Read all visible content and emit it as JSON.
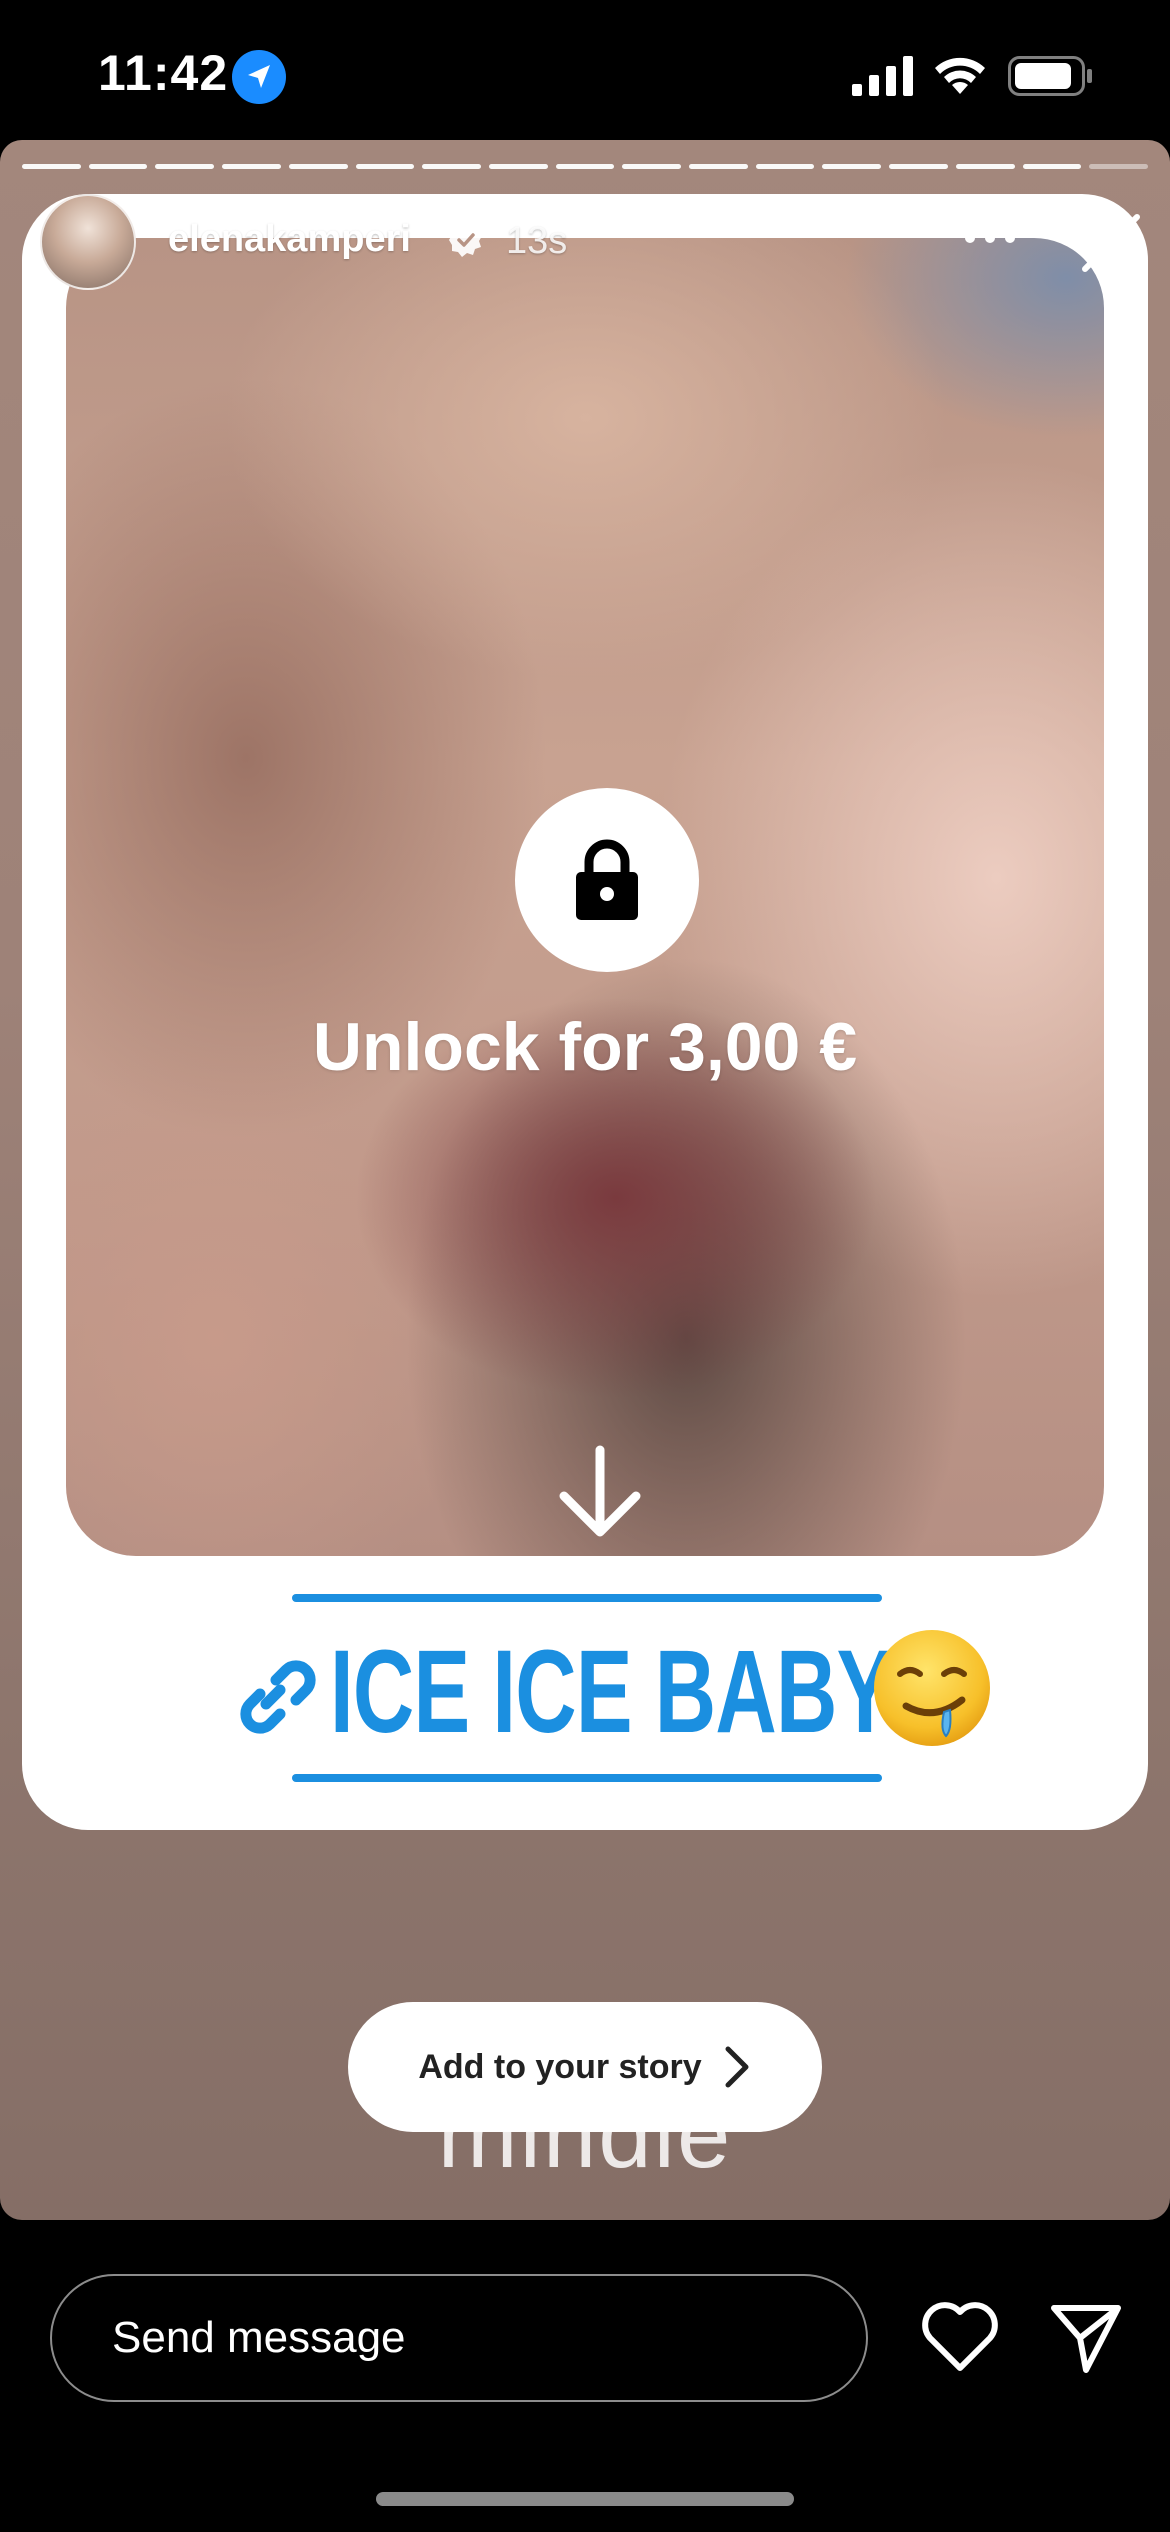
{
  "status_bar": {
    "time": "11:42"
  },
  "story": {
    "progress_segments": 17,
    "progress_done": 16,
    "username": "elenakamperi",
    "time_ago": "13s",
    "unlock_label": "Unlock for 3,00 €",
    "link_sticker_text": "ICE ICE BABY",
    "background_word": "mindie",
    "add_to_story_label": "Add to your story"
  },
  "bottom_bar": {
    "message_placeholder": "Send message"
  },
  "colors": {
    "link_blue": "#1b8fe0",
    "location_blue": "#1a8cff"
  },
  "icons": [
    "location-arrow-icon",
    "signal-icon",
    "wifi-icon",
    "battery-icon",
    "verified-icon",
    "more-icon",
    "close-icon",
    "lock-icon",
    "arrow-down-icon",
    "link-icon",
    "drooling-face-emoji",
    "chevron-right-icon",
    "heart-icon",
    "send-icon"
  ]
}
